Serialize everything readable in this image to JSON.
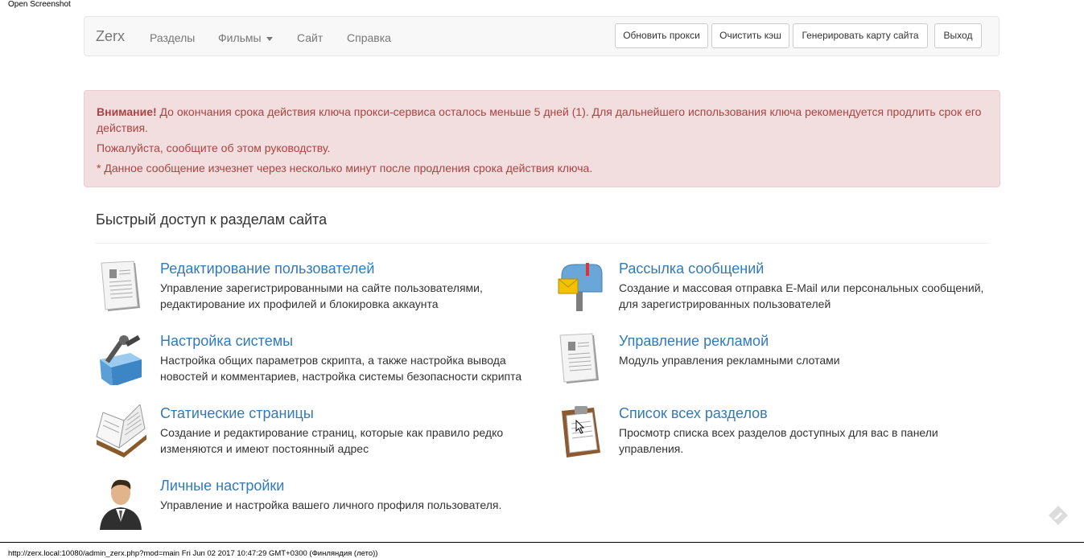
{
  "corner_label": "Open Screenshot",
  "navbar": {
    "brand": "Zerx",
    "links": [
      "Разделы",
      "Фильмы",
      "Сайт",
      "Справка"
    ],
    "buttons": [
      "Обновить прокси",
      "Очистить кэш",
      "Генерировать карту сайта",
      "Выход"
    ]
  },
  "alert": {
    "strong": "Внимание!",
    "line1": " До окончания срока действия ключа прокси-сервиса осталось меньше 5 дней (1). Для дальнейшего использования ключа рекомендуется продлить срок его действия.",
    "line2": "Пожалуйста, сообщите об этом руководству.",
    "line3": "* Данное сообщение изчезнет через несколько минут после продления срока действия ключа."
  },
  "quick_access": {
    "title": "Быстрый доступ к разделам сайта",
    "tiles": [
      {
        "title": "Редактирование пользователей",
        "desc": "Управление зарегистрированными на сайте пользователями, редактирование их профилей и блокировка аккаунта",
        "icon": "document-icon"
      },
      {
        "title": "Рассылка сообщений",
        "desc": "Создание и массовая отправка E-Mail или персональных сообщений, для зарегистрированных пользователей",
        "icon": "mailbox-icon"
      },
      {
        "title": "Настройка системы",
        "desc": "Настройка общих параметров скрипта, а также настройка вывода новостей и комментариев, настройка системы безопасности скрипта",
        "icon": "toolbox-icon"
      },
      {
        "title": "Управление рекламой",
        "desc": "Модуль управления рекламными слотами",
        "icon": "document-icon"
      },
      {
        "title": "Статические страницы",
        "desc": "Создание и редактирование страниц, которые как правило редко изменяются и имеют постоянный адрес",
        "icon": "open-book-icon"
      },
      {
        "title": "Список всех разделов",
        "desc": "Просмотр списка всех разделов доступных для вас в панели управления.",
        "icon": "clipboard-icon"
      },
      {
        "title": "Личные настройки",
        "desc": "Управление и настройка вашего личного профиля пользователя.",
        "icon": "user-avatar-icon"
      }
    ]
  },
  "status_bar": "http://zerx.local:10080/admin_zerx.php?mod=main Fri Jun 02 2017 10:47:29 GMT+0300 (Финляндия (лето))"
}
